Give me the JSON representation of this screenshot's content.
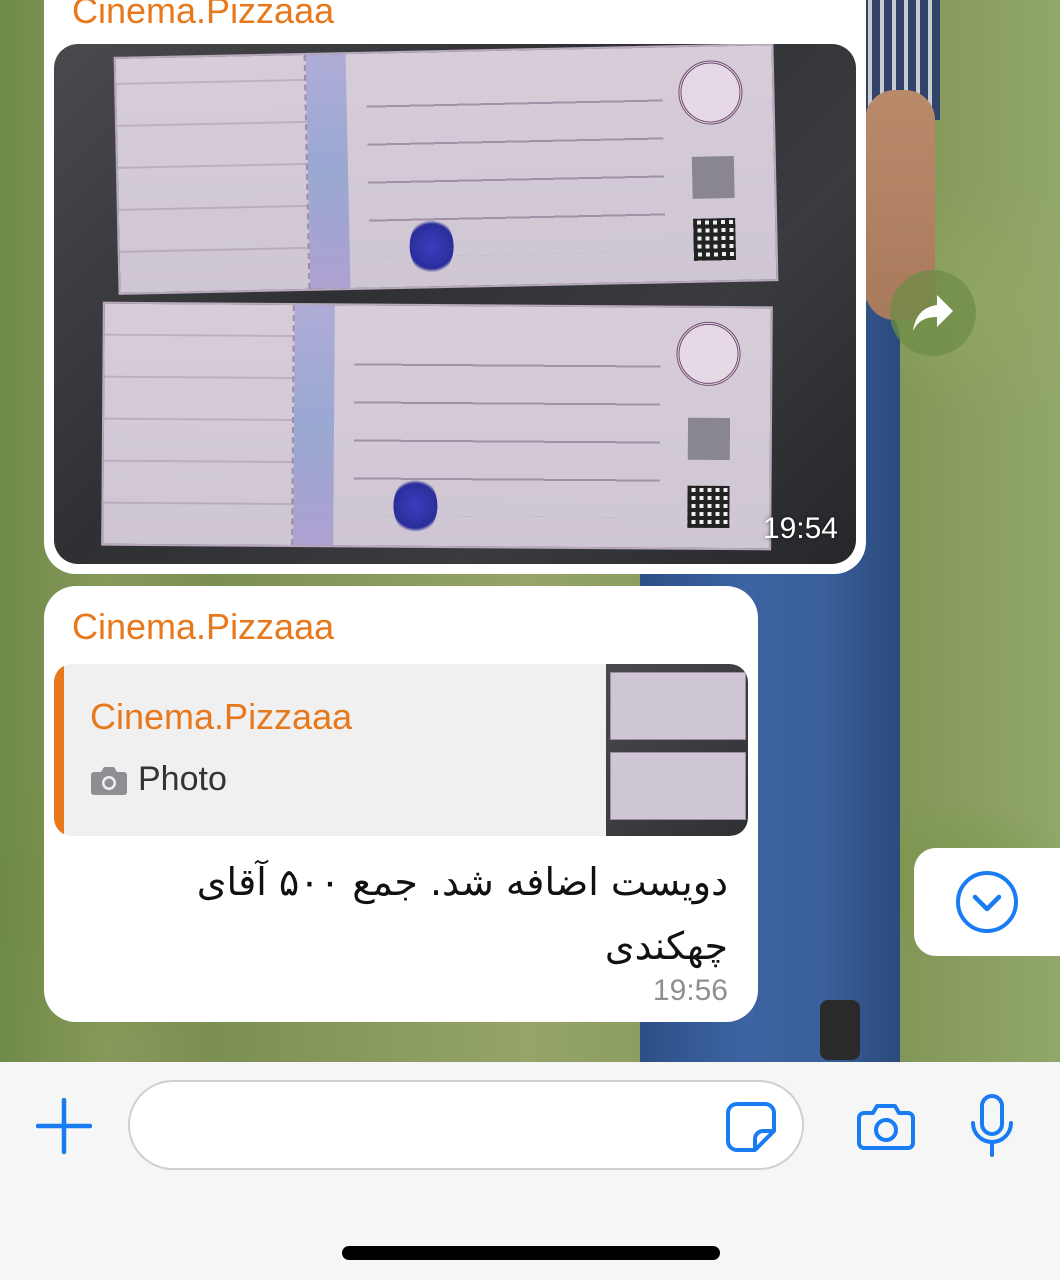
{
  "colors": {
    "accent_orange": "#e8781c",
    "accent_blue": "#1a7cf2",
    "bubble_bg": "#ffffff",
    "timestamp_grey": "#8e8e93"
  },
  "messages": [
    {
      "sender": "Cinema.Pizzaaa",
      "type": "photo",
      "time": "19:54"
    },
    {
      "sender": "Cinema.Pizzaaa",
      "reply_to": {
        "sender": "Cinema.Pizzaaa",
        "type_icon": "camera-icon",
        "type_label": "Photo"
      },
      "text": "دویست اضافه شد. جمع ۵۰۰ آقای چهکندی",
      "time": "19:56"
    }
  ],
  "actions": {
    "forward_icon": "forward-arrow-icon",
    "scroll_down_icon": "chevron-down-circle-icon"
  },
  "composer": {
    "attach_icon": "plus-icon",
    "input_value": "",
    "sticker_icon": "sticker-icon",
    "camera_icon": "camera-icon",
    "mic_icon": "microphone-icon"
  }
}
